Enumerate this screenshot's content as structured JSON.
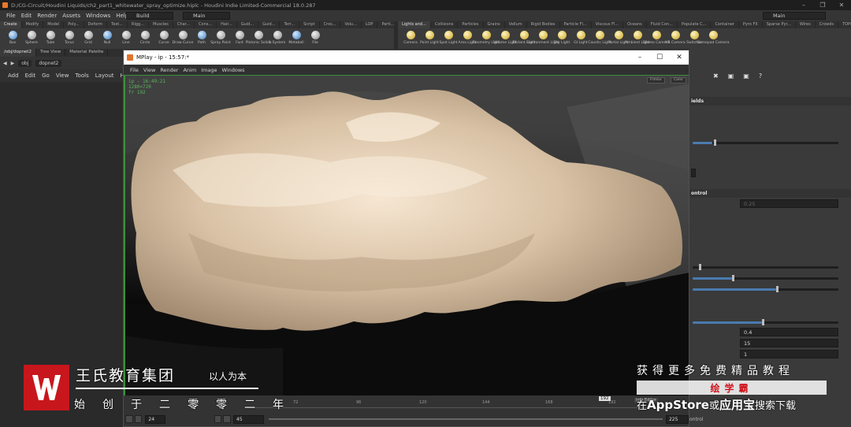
{
  "window": {
    "title": "D:/CG-Circuit/Houdini Liquids/ch2_part1_whitewater_spray_optimize.hiplc - Houdini Indie Limited-Commercial 18.0.287"
  },
  "menubar": {
    "items": [
      "File",
      "Edit",
      "Render",
      "Assets",
      "Windows",
      "Help"
    ],
    "desktop_left": "Build",
    "desktop_mid": "Main",
    "desktop_right": "Main"
  },
  "shelf_left": {
    "tabs": [
      "Create",
      "Modify",
      "Model",
      "Poly...",
      "Deform",
      "Text...",
      "Rigg...",
      "Muscles",
      "Char...",
      "Cons...",
      "Hair...",
      "Guid...",
      "Guid...",
      "Terr...",
      "Script",
      "Cros...",
      "Volu...",
      "LOP",
      "Parti..."
    ],
    "tools": [
      "Box",
      "Sphere",
      "Tube",
      "Torus",
      "Grid",
      "Null",
      "Line",
      "Circle",
      "Curve",
      "Draw Curve",
      "Path",
      "Spray Paint",
      "Font",
      "Platonic Solids",
      "L-System",
      "Metaball",
      "File"
    ]
  },
  "shelf_right": {
    "tabs": [
      "Lights and...",
      "Collisions",
      "Particles",
      "Grains",
      "Vellum",
      "Rigid Bodies",
      "Particle Fl...",
      "Viscous Fl...",
      "Oceans",
      "Fluid Con...",
      "Populate C...",
      "Container",
      "Pyro FX",
      "Sparse Pyr...",
      "Wires",
      "Crowds",
      "TOPs",
      "Drive Sim"
    ],
    "tools": [
      "Camera",
      "Point Light",
      "Spot Light",
      "Area Light",
      "Geometry Light",
      "Volume Light",
      "Distant Light",
      "Environment Light",
      "Sky Light",
      "GI Light",
      "Caustic Light",
      "Portal Light",
      "Ambient Light",
      "Stereo Camera",
      "VR Camera",
      "Switcher",
      "Gamepad Camera"
    ]
  },
  "left_pane": {
    "tabs": [
      "/obj/dopnet2",
      "Tree View",
      "Material Palette"
    ],
    "crumbs": [
      "obj",
      "dopnet2"
    ],
    "menu": [
      "Add",
      "Edit",
      "Go",
      "View",
      "Tools",
      "Layout",
      "Help"
    ]
  },
  "right_pane": {
    "header1": "ields",
    "header2": "ontrol",
    "value_025": "0.25",
    "value_04": "0.4",
    "value_15": "15",
    "value_1": "1",
    "bottom_label": "ontrol"
  },
  "mplay": {
    "title": "MPlay - ip - 15:57:*",
    "menu": [
      "File",
      "View",
      "Render",
      "Anim",
      "Image",
      "Windows"
    ],
    "hud": [
      "ip - 16:49:21",
      "1280×720",
      "fr 192"
    ],
    "vp_options": [
      "Filmbx",
      "Camr"
    ],
    "timeline": {
      "ticks": [
        "72",
        "96",
        "120",
        "144",
        "168",
        "192"
      ],
      "current_frame": "192",
      "fps": "24",
      "start": "45",
      "end": "225",
      "frame_field": "192"
    },
    "info_label": "Info Editor"
  },
  "watermark": {
    "brand": "王氏教育集团",
    "motto": "以人为本",
    "founded": "始创于二零零二年",
    "promo_line1": "获得更多免费精品教程",
    "promo_badge": "绘学霸",
    "promo_line2_pre": "在",
    "promo_line2_app": "AppStore",
    "promo_line2_mid": "或",
    "promo_line2_store": "应用宝",
    "promo_line2_post": "搜索下载"
  },
  "colors": {
    "accent_red": "#c8161d",
    "hud_green": "#5fb45f",
    "foam": "#d8c3a8"
  }
}
